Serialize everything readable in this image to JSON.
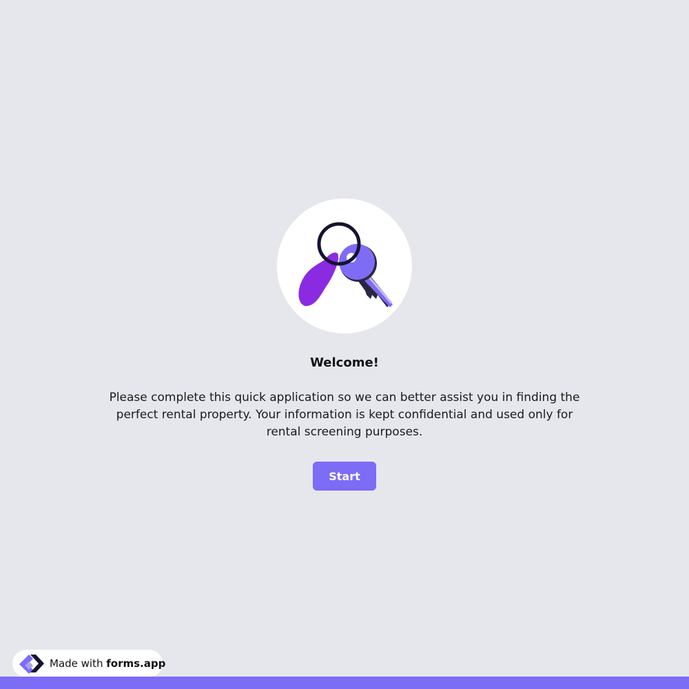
{
  "welcome": {
    "title": "Welcome!",
    "description": "Please complete this quick application so we can better assist you in finding the perfect rental property. Your information is kept confidential and used only for rental screening purposes.",
    "start_label": "Start",
    "image_icon": "keys-icon"
  },
  "footer": {
    "made_with_label": "Made with",
    "brand": "forms.app",
    "logo_icon": "forms-app-logo-icon"
  },
  "colors": {
    "background": "#e6e7ed",
    "accent": "#7c6cf6",
    "tag": "#8a2be2",
    "key": "#7f6cf5",
    "ring": "#151332"
  }
}
